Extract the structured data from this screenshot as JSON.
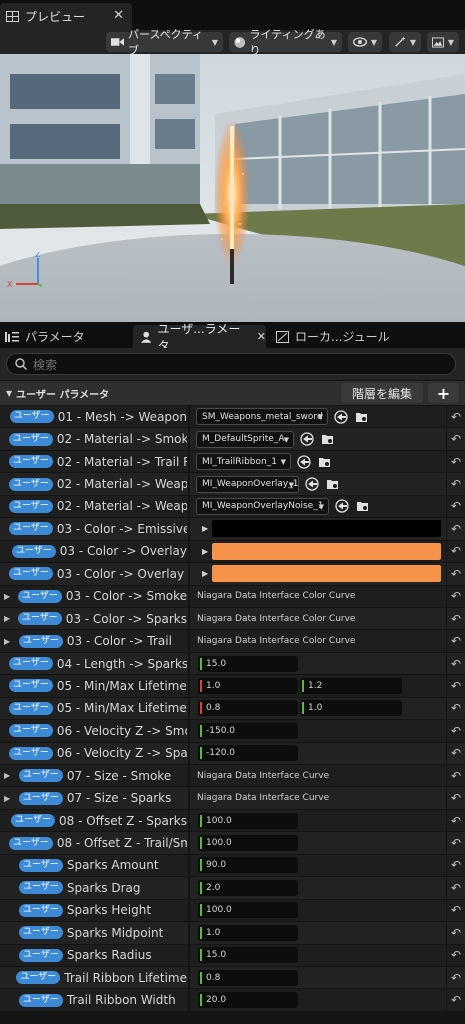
{
  "preview_tab": {
    "title": "プレビュー"
  },
  "toolbar": {
    "perspective_label": "パースペクティブ",
    "lighting_label": "ライティングあり"
  },
  "lower_tabs": [
    {
      "label": "パラメータ"
    },
    {
      "label": "ユーザ...ラメータ"
    },
    {
      "label": "ローカ...ジュール"
    }
  ],
  "search": {
    "placeholder": "検索"
  },
  "section": {
    "title": "ユーザー パラメータ",
    "edit_label": "階層を編集",
    "add_label": "+"
  },
  "badge_label": "ユーザー",
  "colors": {
    "black": "#000000",
    "orange": "#f7924a",
    "badge": "#3d8bd6"
  },
  "rows": [
    {
      "name": "01 - Mesh -> Weapon",
      "type": "asset",
      "value": "SM_Weapons_metal_sword"
    },
    {
      "name": "02 - Material -> Smoke",
      "type": "asset",
      "value": "M_DefaultSprite_A"
    },
    {
      "name": "02 - Material -> Trail Rib",
      "type": "asset",
      "value": "MI_TrailRibbon_1"
    },
    {
      "name": "02 - Material -> Weapon",
      "type": "asset",
      "value": "MI_WeaponOverlay_1"
    },
    {
      "name": "02 - Material -> Weapon",
      "type": "asset",
      "value": "MI_WeaponOverlayNoise_1"
    },
    {
      "name": "03 - Color -> Emissive",
      "type": "color",
      "value": "#000000"
    },
    {
      "name": "03 - Color -> Overlay",
      "type": "color",
      "value": "#f7924a"
    },
    {
      "name": "03 - Color -> Overlay No",
      "type": "color",
      "value": "#f7924a"
    },
    {
      "name": "03 - Color -> Smoke",
      "type": "curve",
      "value": "Niagara Data Interface Color Curve"
    },
    {
      "name": "03 - Color -> Sparks",
      "type": "curve",
      "value": "Niagara Data Interface Color Curve"
    },
    {
      "name": "03 - Color -> Trail",
      "type": "curve",
      "value": "Niagara Data Interface Color Curve"
    },
    {
      "name": "04 - Length -> Sparks",
      "type": "num",
      "value": "15.0"
    },
    {
      "name": "05 - Min/Max Lifetime -",
      "type": "num2",
      "value": "1.0",
      "value2": "1.2"
    },
    {
      "name": "05 - Min/Max Lifetime -",
      "type": "num2",
      "value": "0.8",
      "value2": "1.0"
    },
    {
      "name": "06 - Velocity Z -> Smok",
      "type": "num",
      "value": "-150.0"
    },
    {
      "name": "06 - Velocity Z -> Spark",
      "type": "num",
      "value": "-120.0"
    },
    {
      "name": "07 - Size - Smoke",
      "type": "curve",
      "value": "Niagara Data Interface Curve"
    },
    {
      "name": "07 - Size - Sparks",
      "type": "curve",
      "value": "Niagara Data Interface Curve"
    },
    {
      "name": "08 - Offset Z - Sparks",
      "type": "num",
      "value": "100.0"
    },
    {
      "name": "08 - Offset Z - Trail/Sm",
      "type": "num",
      "value": "100.0"
    },
    {
      "name": "Sparks Amount",
      "type": "num",
      "value": "90.0"
    },
    {
      "name": "Sparks Drag",
      "type": "num",
      "value": "2.0"
    },
    {
      "name": "Sparks Height",
      "type": "num",
      "value": "100.0"
    },
    {
      "name": "Sparks Midpoint",
      "type": "num",
      "value": "1.0"
    },
    {
      "name": "Sparks Radius",
      "type": "num",
      "value": "15.0"
    },
    {
      "name": "Trail Ribbon Lifetime",
      "type": "num",
      "value": "0.8"
    },
    {
      "name": "Trail Ribbon Width",
      "type": "num",
      "value": "20.0"
    }
  ]
}
